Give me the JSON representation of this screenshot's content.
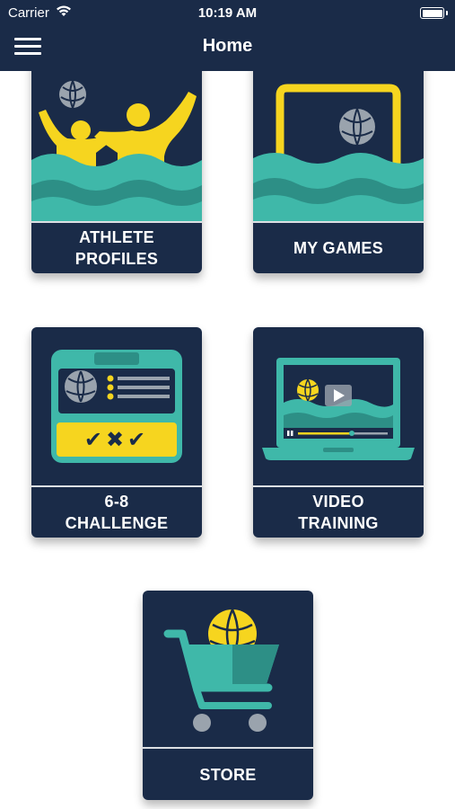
{
  "status_bar": {
    "carrier": "Carrier",
    "time": "10:19 AM",
    "icons": [
      "wifi-icon",
      "battery-icon"
    ]
  },
  "nav": {
    "title": "Home",
    "menu_icon": "hamburger-menu-icon"
  },
  "tiles": [
    {
      "label": "ATHLETE PROFILES",
      "icon": "swimmers-with-ball-illustration"
    },
    {
      "label": "MY GAMES",
      "icon": "goal-with-ball-illustration"
    },
    {
      "label": "6-8 CHALLENGE",
      "icon": "scoreboard-checklist-illustration",
      "marks": "✔✖✔"
    },
    {
      "label": "VIDEO TRAINING",
      "icon": "laptop-video-player-illustration"
    },
    {
      "label": "STORE",
      "icon": "shopping-cart-with-ball-illustration"
    }
  ],
  "colors": {
    "navy": "#1a2b48",
    "teal": "#3fb8a9",
    "teal_dark": "#2d8f86",
    "yellow": "#f6d51f",
    "grey_ball": "#9aa3ad",
    "background": "#ffffff"
  }
}
